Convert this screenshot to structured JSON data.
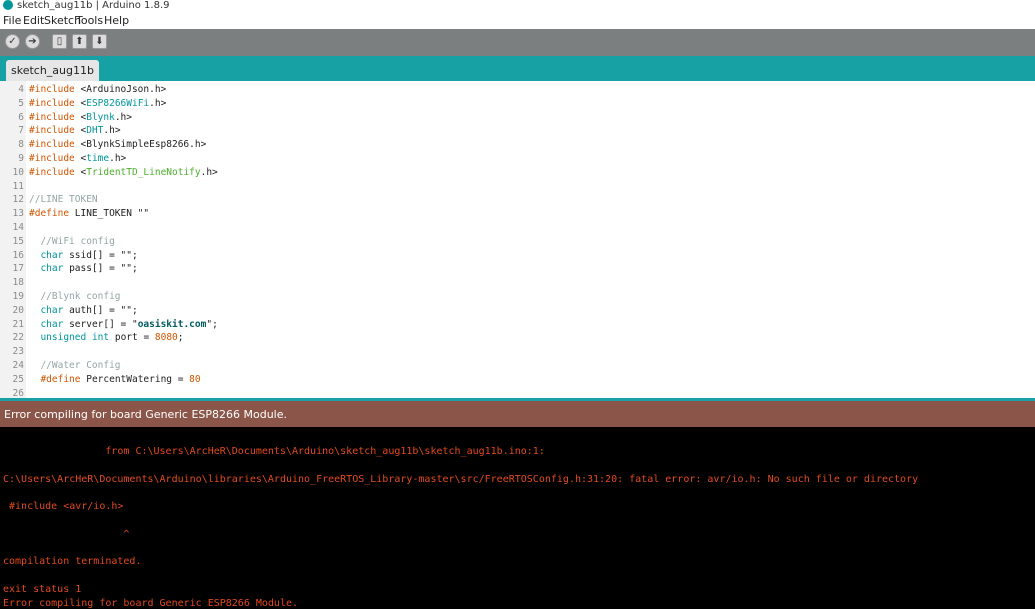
{
  "window": {
    "title": "sketch_aug11b | Arduino 1.8.9",
    "logo_icon": "arduino-logo-icon"
  },
  "menu": [
    "File",
    "Edit",
    "Sketch",
    "Tools",
    "Help"
  ],
  "toolbar": {
    "buttons": [
      {
        "name": "verify",
        "icon": "check-icon",
        "glyph": "✓"
      },
      {
        "name": "upload",
        "icon": "arrow-right-icon",
        "glyph": "➔"
      },
      {
        "name": "new",
        "icon": "new-file-icon",
        "glyph": "▯"
      },
      {
        "name": "open",
        "icon": "arrow-up-icon",
        "glyph": "⬆"
      },
      {
        "name": "save",
        "icon": "arrow-down-icon",
        "glyph": "⬇"
      }
    ]
  },
  "tab": {
    "label": "sketch_aug11b"
  },
  "editor": {
    "lines": [
      {
        "n": "4",
        "parts": [
          [
            "hl",
            "#include"
          ],
          [
            "",
            "<ArduinoJson.h>"
          ]
        ]
      },
      {
        "n": "5",
        "parts": [
          [
            "hl",
            "#include"
          ],
          [
            "",
            "<"
          ],
          [
            "lib",
            "ESP8266WiFi"
          ],
          [
            "",
            ".h>"
          ]
        ]
      },
      {
        "n": "6",
        "parts": [
          [
            "hl",
            "#include"
          ],
          [
            "",
            "<"
          ],
          [
            "lib",
            "Blynk"
          ],
          [
            "",
            ".h>"
          ]
        ]
      },
      {
        "n": "7",
        "parts": [
          [
            "hl",
            "#include"
          ],
          [
            "",
            "<"
          ],
          [
            "lib",
            "DHT"
          ],
          [
            "",
            ".h>"
          ]
        ]
      },
      {
        "n": "8",
        "parts": [
          [
            "hl",
            "#include"
          ],
          [
            "",
            "<BlynkSimpleEsp8266.h>"
          ]
        ]
      },
      {
        "n": "9",
        "parts": [
          [
            "hl",
            "#include"
          ],
          [
            "",
            "<"
          ],
          [
            "lib",
            "time"
          ],
          [
            "",
            ".h>"
          ]
        ]
      },
      {
        "n": "10",
        "parts": [
          [
            "hl",
            "#include"
          ],
          [
            "",
            "<"
          ],
          [
            "libg",
            "TridentTD_LineNotify"
          ],
          [
            "",
            ".h>"
          ]
        ]
      },
      {
        "n": "11",
        "parts": []
      },
      {
        "n": "12",
        "parts": [
          [
            "cm",
            "//LINE TOKEN"
          ]
        ]
      },
      {
        "n": "13",
        "parts": [
          [
            "hl",
            "#define"
          ],
          [
            "",
            " LINE_TOKEN \"\""
          ]
        ]
      },
      {
        "n": "14",
        "parts": []
      },
      {
        "n": "15",
        "parts": [
          [
            "cm",
            "  //WiFi config"
          ]
        ]
      },
      {
        "n": "16",
        "parts": [
          [
            "",
            "  "
          ],
          [
            "ty",
            "char"
          ],
          [
            "",
            " ssid[] = \"\";"
          ]
        ]
      },
      {
        "n": "17",
        "parts": [
          [
            "",
            "  "
          ],
          [
            "ty",
            "char"
          ],
          [
            "",
            " pass[] = \"\";"
          ]
        ]
      },
      {
        "n": "18",
        "parts": []
      },
      {
        "n": "19",
        "parts": [
          [
            "cm",
            "  //Blynk config"
          ]
        ]
      },
      {
        "n": "20",
        "parts": [
          [
            "",
            "  "
          ],
          [
            "ty",
            "char"
          ],
          [
            "",
            " auth[] = \"\";"
          ]
        ]
      },
      {
        "n": "21",
        "parts": [
          [
            "",
            "  "
          ],
          [
            "ty",
            "char"
          ],
          [
            "",
            " server[] = \""
          ],
          [
            "str",
            "oasiskit.com"
          ],
          [
            "",
            "\";"
          ]
        ]
      },
      {
        "n": "22",
        "parts": [
          [
            "",
            "  "
          ],
          [
            "ty",
            "unsigned"
          ],
          [
            "",
            " "
          ],
          [
            "ty",
            "int"
          ],
          [
            "",
            " port = "
          ],
          [
            "num",
            "8080"
          ],
          [
            "",
            ";"
          ]
        ]
      },
      {
        "n": "23",
        "parts": []
      },
      {
        "n": "24",
        "parts": [
          [
            "cm",
            "  //Water Config"
          ]
        ]
      },
      {
        "n": "25",
        "parts": [
          [
            "",
            "  "
          ],
          [
            "hl",
            "#define"
          ],
          [
            "",
            " PercentWatering = "
          ],
          [
            "num",
            "80"
          ]
        ]
      },
      {
        "n": "26",
        "parts": []
      }
    ]
  },
  "status": {
    "message": "Error compiling for board Generic ESP8266 Module."
  },
  "console": {
    "lines": [
      "                 from C:\\Users\\ArcHeR\\Documents\\Arduino\\sketch_aug11b\\sketch_aug11b.ino:1:",
      "",
      "C:\\Users\\ArcHeR\\Documents\\Arduino\\libraries\\Arduino_FreeRTOS_Library-master\\src/FreeRTOSConfig.h:31:20: fatal error: avr/io.h: No such file or directory",
      "",
      " #include <avr/io.h>",
      "",
      "                    ^",
      "",
      "compilation terminated.",
      "",
      "exit status 1",
      "Error compiling for board Generic ESP8266 Module."
    ]
  },
  "colors": {
    "toolbar": "#7c7f80",
    "tabbar": "#17a1a5",
    "status_error": "#8b5649",
    "console_text": "#e34a1c"
  }
}
